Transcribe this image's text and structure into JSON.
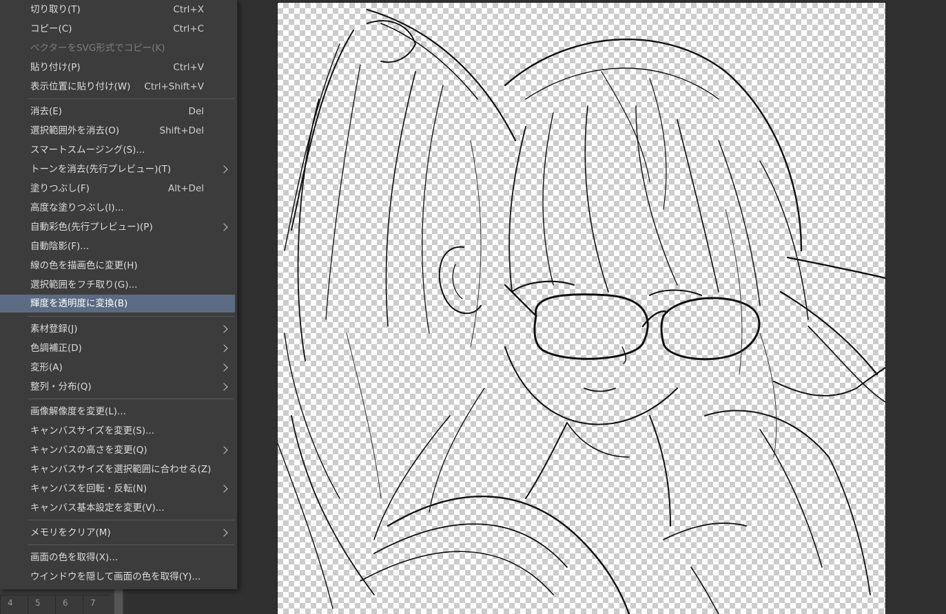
{
  "menu": {
    "items": [
      {
        "label": "切り取り(T)",
        "shortcut": "Ctrl+X"
      },
      {
        "label": "コピー(C)",
        "shortcut": "Ctrl+C"
      },
      {
        "label": "ベクターをSVG形式でコピー(K)",
        "disabled": true
      },
      {
        "label": "貼り付け(P)",
        "shortcut": "Ctrl+V"
      },
      {
        "label": "表示位置に貼り付け(W)",
        "shortcut": "Ctrl+Shift+V"
      },
      {
        "label": "消去(E)",
        "shortcut": "Del"
      },
      {
        "label": "選択範囲外を消去(O)",
        "shortcut": "Shift+Del"
      },
      {
        "label": "スマートスムージング(S)..."
      },
      {
        "label": "トーンを消去(先行プレビュー)(T)",
        "submenu": true
      },
      {
        "label": "塗りつぶし(F)",
        "shortcut": "Alt+Del"
      },
      {
        "label": "高度な塗りつぶし(I)..."
      },
      {
        "label": "自動彩色(先行プレビュー)(P)",
        "submenu": true
      },
      {
        "label": "自動陰影(F)..."
      },
      {
        "label": "線の色を描画色に変更(H)"
      },
      {
        "label": "選択範囲をフチ取り(G)..."
      },
      {
        "label": "輝度を透明度に変換(B)",
        "highlighted": true
      },
      {
        "label": "素材登録(J)",
        "submenu": true
      },
      {
        "label": "色調補正(D)",
        "submenu": true
      },
      {
        "label": "変形(A)",
        "submenu": true
      },
      {
        "label": "整列・分布(Q)",
        "submenu": true
      },
      {
        "label": "画像解像度を変更(L)..."
      },
      {
        "label": "キャンバスサイズを変更(S)..."
      },
      {
        "label": "キャンバスの高さを変更(Q)",
        "submenu": true
      },
      {
        "label": "キャンバスサイズを選択範囲に合わせる(Z)"
      },
      {
        "label": "キャンバスを回転・反転(N)",
        "submenu": true
      },
      {
        "label": "キャンバス基本設定を変更(V)..."
      },
      {
        "label": "メモリをクリア(M)",
        "submenu": true
      },
      {
        "label": "画面の色を取得(X)..."
      },
      {
        "label": "ウインドウを隠して画面の色を取得(Y)..."
      }
    ]
  },
  "palette": {
    "cells": [
      "4",
      "5",
      "6",
      "7"
    ]
  },
  "canvas": {
    "description_icon": "line-art-canvas",
    "stroke_color": "#111111",
    "background": "transparent-checkerboard"
  },
  "colors": {
    "menu_bg": "#3c3c3c",
    "highlight": "#5c6b84",
    "workspace": "#303030"
  }
}
